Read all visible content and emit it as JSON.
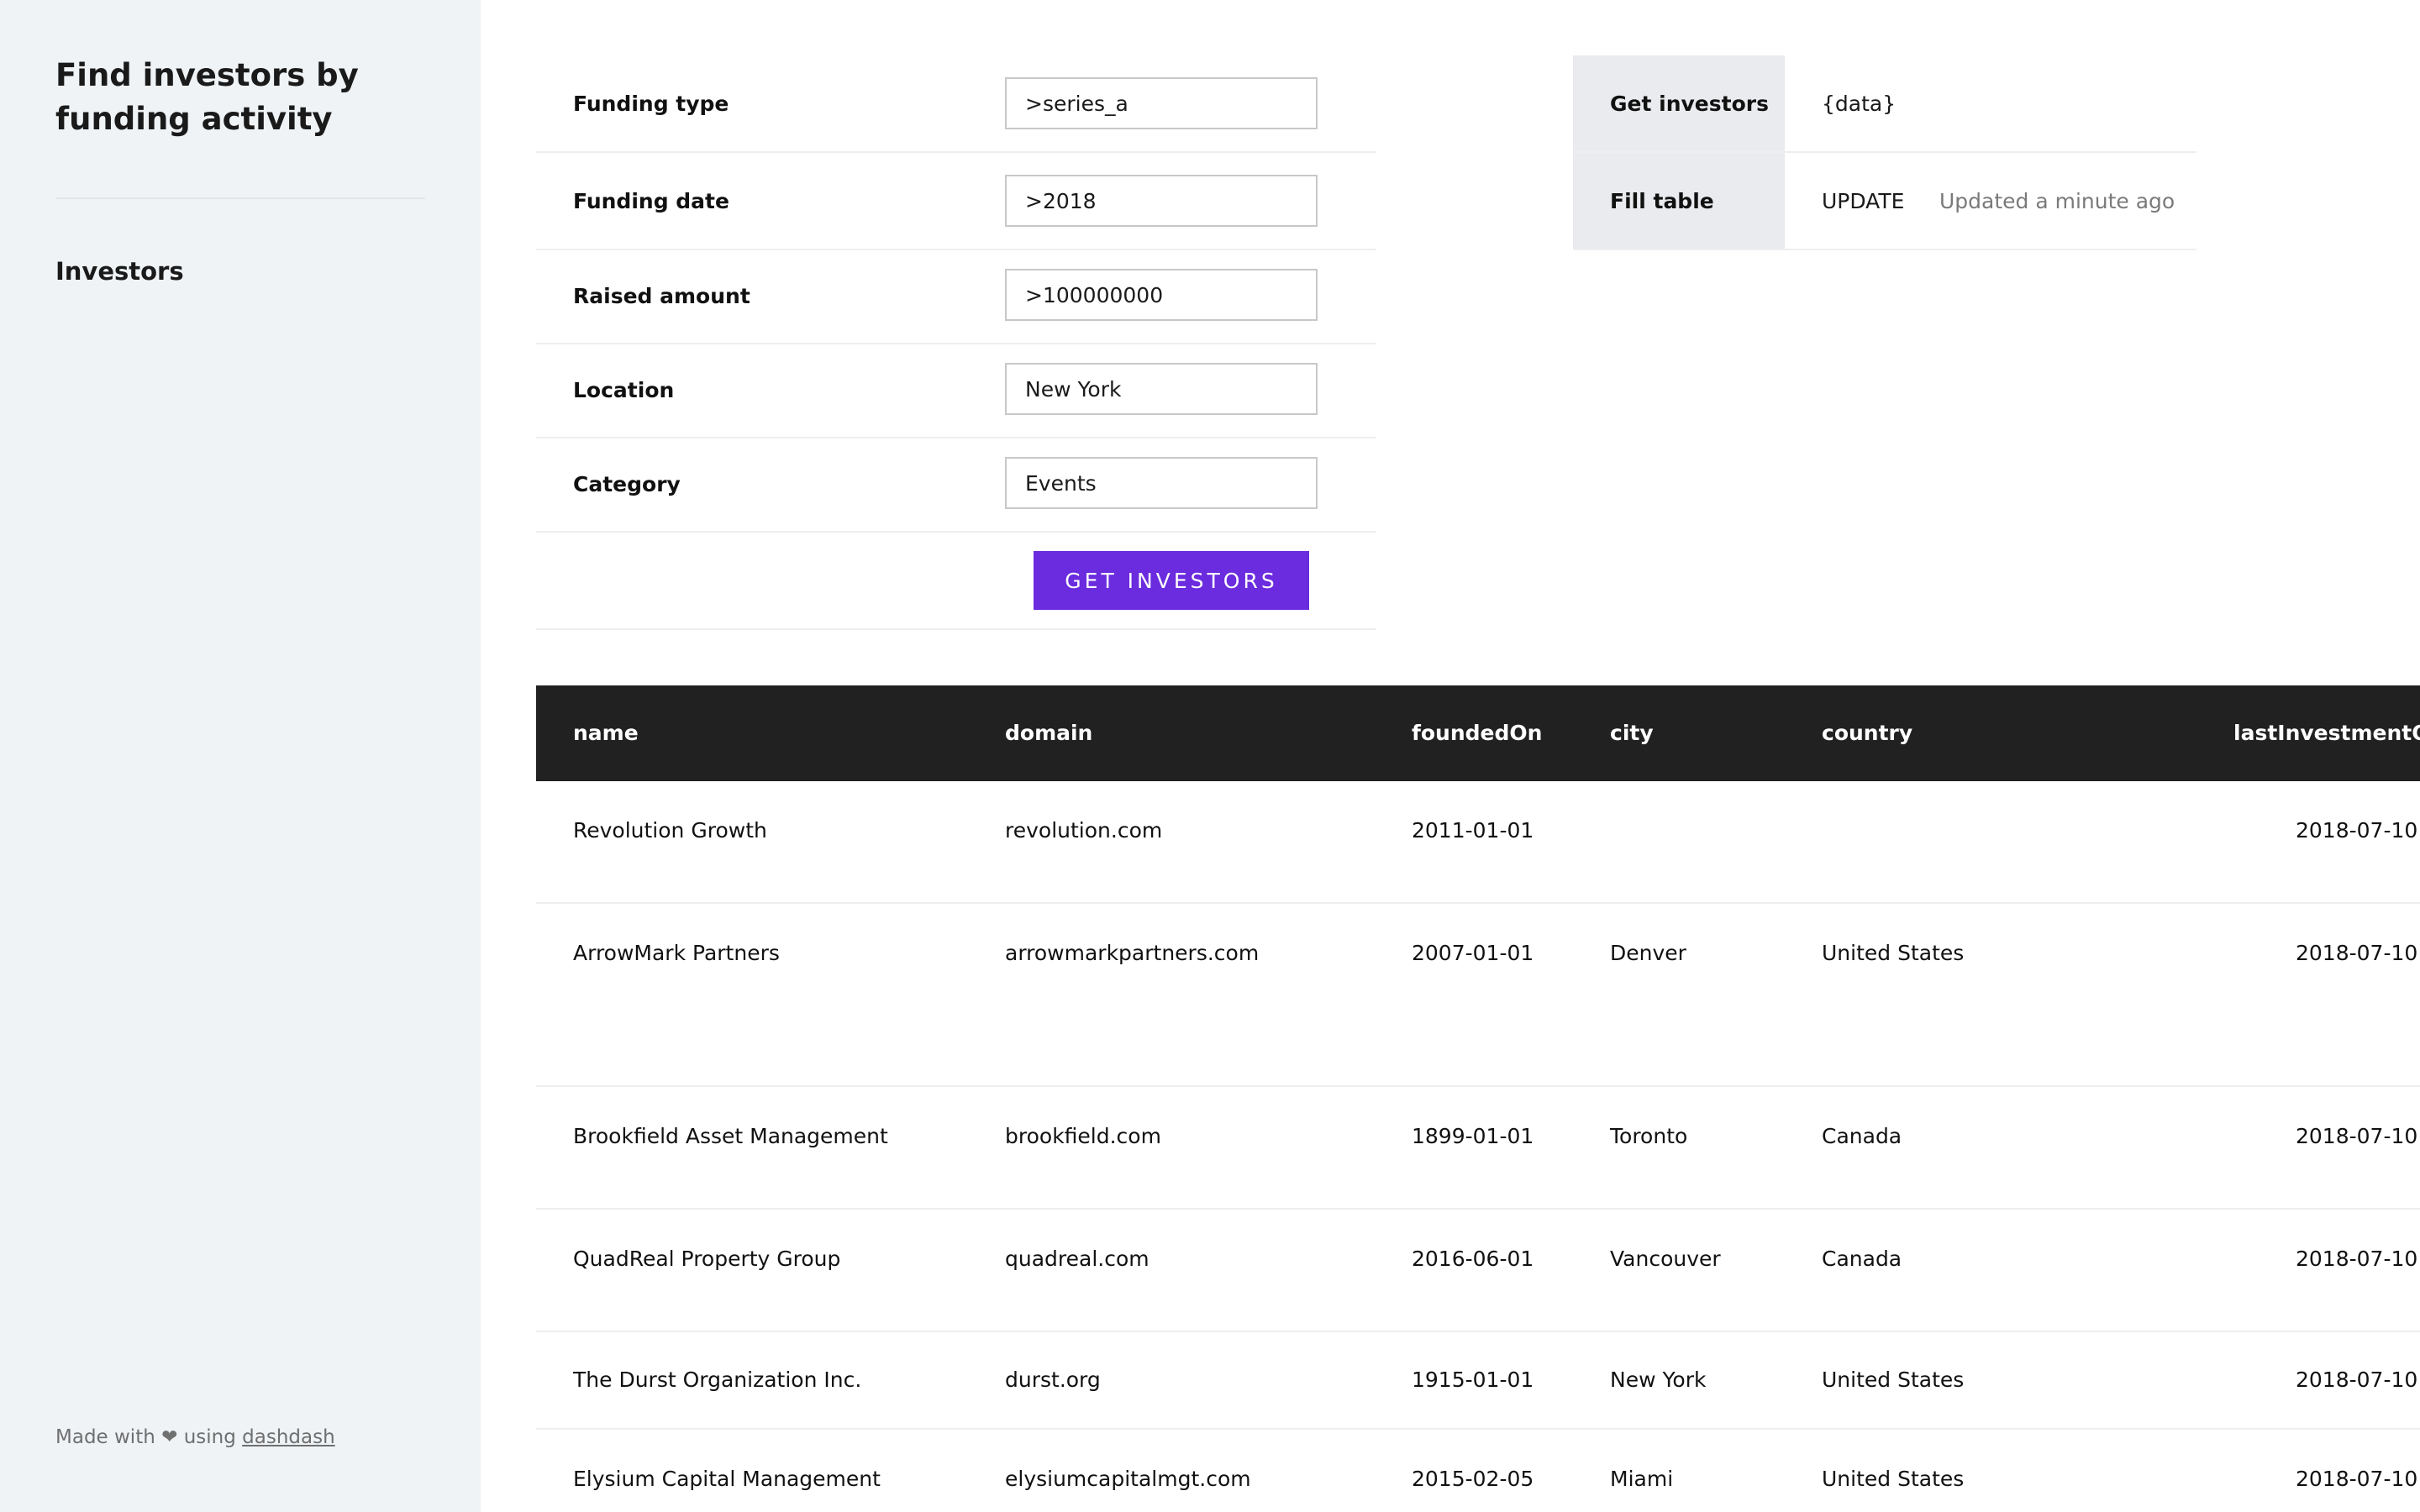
{
  "sidebar": {
    "title": "Find investors by funding activity",
    "nav_item": "Investors",
    "footer_prefix": "Made with",
    "footer_heart": "❤",
    "footer_using": "using",
    "footer_link": "dashdash"
  },
  "form": {
    "fields": [
      {
        "label": "Funding type",
        "value": ">series_a"
      },
      {
        "label": "Funding date",
        "value": ">2018"
      },
      {
        "label": "Raised amount",
        "value": ">100000000"
      },
      {
        "label": "Location",
        "value": "New York"
      },
      {
        "label": "Category",
        "value": "Events"
      }
    ],
    "submit_label": "GET INVESTORS"
  },
  "queries": [
    {
      "name": "Get investors",
      "value": "{data}"
    },
    {
      "name": "Fill table",
      "action": "UPDATE",
      "status": "Updated a minute ago"
    }
  ],
  "table": {
    "columns": [
      "name",
      "domain",
      "foundedOn",
      "city",
      "country",
      "lastInvestmentOn"
    ],
    "rows": [
      [
        "Revolution Growth",
        "revolution.com",
        "2011-01-01",
        "",
        "",
        "2018-07-10"
      ],
      [
        "ArrowMark Partners",
        "arrowmarkpartners.com",
        "2007-01-01",
        "Denver",
        "United States",
        "2018-07-10"
      ],
      [
        "Brookfield Asset Management",
        "brookfield.com",
        "1899-01-01",
        "Toronto",
        "Canada",
        "2018-07-10"
      ],
      [
        "QuadReal Property Group",
        "quadreal.com",
        "2016-06-01",
        "Vancouver",
        "Canada",
        "2018-07-10"
      ],
      [
        "The Durst Organization Inc.",
        "durst.org",
        "1915-01-01",
        "New York",
        "United States",
        "2018-07-10"
      ],
      [
        "Elysium Capital Management",
        "elysiumcapitalmgt.com",
        "2015-02-05",
        "Miami",
        "United States",
        "2018-07-10"
      ]
    ]
  }
}
